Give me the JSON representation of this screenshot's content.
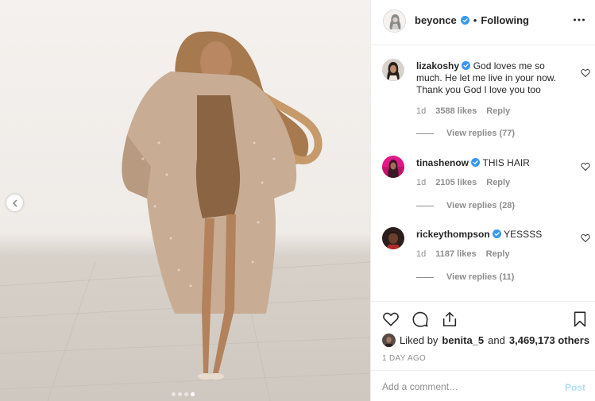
{
  "post": {
    "author": "beyonce",
    "follow_status": "Following",
    "separator": "•"
  },
  "comments": [
    {
      "user": "lizakoshy",
      "text": "God loves me so much. He let me live in your now. Thank you God I love you too",
      "age": "1d",
      "likes": "3588 likes",
      "reply_label": "Reply",
      "view_replies": "View replies (77)"
    },
    {
      "user": "tinashenow",
      "text": "THIS HAIR",
      "age": "1d",
      "likes": "2105 likes",
      "reply_label": "Reply",
      "view_replies": "View replies (28)"
    },
    {
      "user": "rickeythompson",
      "text": "YESSSS",
      "age": "1d",
      "likes": "1187 likes",
      "reply_label": "Reply",
      "view_replies": "View replies (11)"
    }
  ],
  "likes": {
    "prefix": "Liked by",
    "user": "benita_5",
    "conjunction": "and",
    "others": "3,469,173 others"
  },
  "timestamp": "1 DAY AGO",
  "composer": {
    "placeholder": "Add a comment…",
    "post_label": "Post"
  },
  "carousel": {
    "slide_count": 4,
    "active_index": 3
  },
  "icons": {
    "verified": "verified-badge-icon",
    "more": "more-options-icon",
    "heart": "heart-icon",
    "comment": "comment-icon",
    "share": "share-icon",
    "save": "bookmark-icon",
    "prev": "chevron-left-icon"
  },
  "colors": {
    "verified_blue": "#3897f0",
    "link_blue_disabled": "#b2dffc",
    "muted_text": "#8e8e8e",
    "primary_text": "#262626"
  }
}
